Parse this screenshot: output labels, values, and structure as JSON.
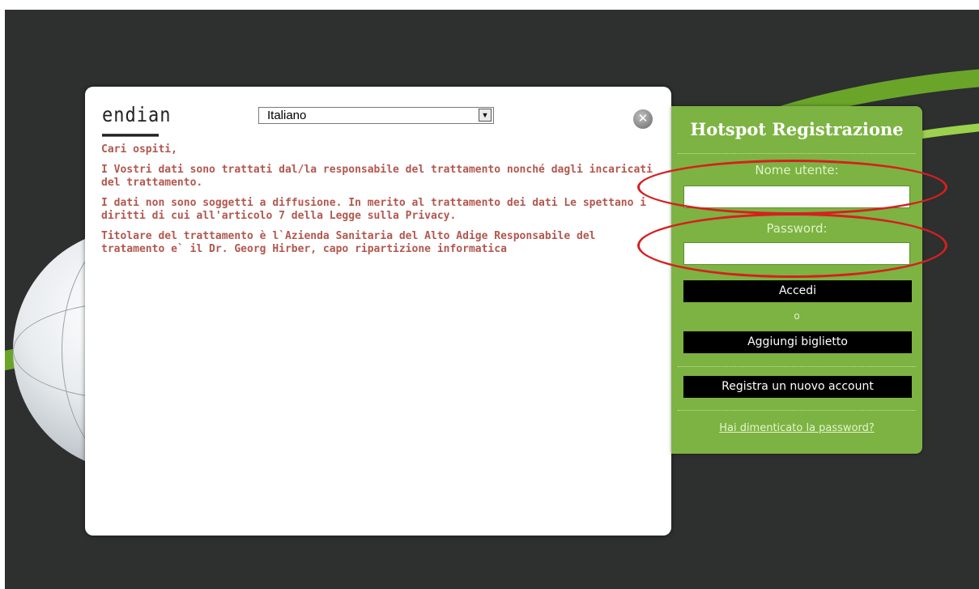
{
  "dialog": {
    "logo_text": "endian",
    "language": {
      "selected": "Italiano"
    },
    "close_glyph": "✕",
    "paragraphs": [
      "Cari ospiti,",
      "I Vostri dati sono trattati dal/la responsabile del trattamento nonché dagli incaricati del trattamento.",
      "I dati non sono soggetti a diffusione. In merito al trattamento dei dati Le spettano i diritti di cui all'articolo 7 della Legge sulla Privacy.",
      "Titolare del trattamento è l`Azienda Sanitaria del Alto Adige Responsabile del tratamento e` il Dr. Georg Hirber, capo ripartizione informatica"
    ]
  },
  "panel": {
    "title": "Hotspot Registrazione",
    "username_label": "Nome utente:",
    "username_value": "",
    "password_label": "Password:",
    "password_value": "",
    "login_button": "Accedi",
    "or_text": "o",
    "add_ticket_button": "Aggiungi biglietto",
    "register_button": "Registra un nuovo account",
    "forgot_link": "Hai dimenticato la password?"
  },
  "colors": {
    "background": "#2e2f2f",
    "panel_green": "#7cb342",
    "text_red": "#b2574f",
    "annotation_red": "#d62020"
  },
  "icons": {
    "close": "close-icon",
    "dropdown": "chevron-down-icon"
  }
}
